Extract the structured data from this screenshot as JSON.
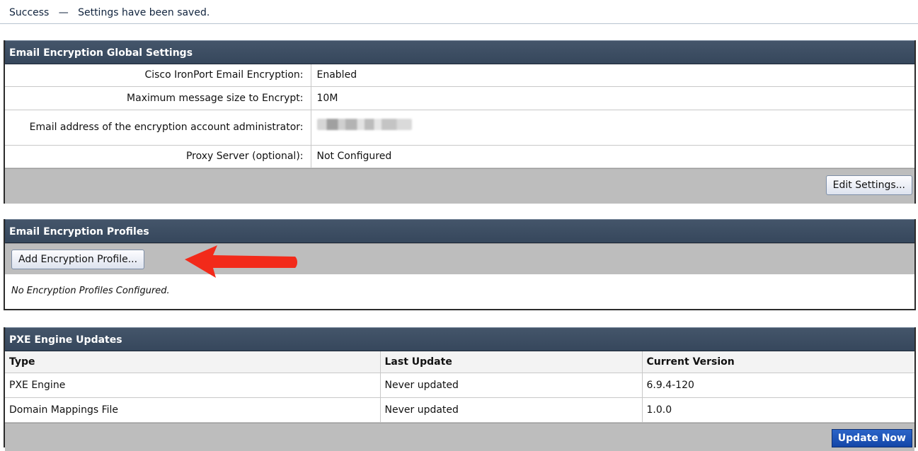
{
  "notification": {
    "status": "Success",
    "separator": "—",
    "message": "Settings have been saved."
  },
  "global_settings": {
    "title": "Email Encryption Global Settings",
    "rows": [
      {
        "label": "Cisco IronPort Email Encryption:",
        "value": "Enabled"
      },
      {
        "label": "Maximum message size to Encrypt:",
        "value": "10M"
      },
      {
        "label": "Email address of the encryption account administrator:",
        "value": ""
      },
      {
        "label": "Proxy Server (optional):",
        "value": "Not Configured"
      }
    ],
    "edit_button": "Edit Settings..."
  },
  "profiles": {
    "title": "Email Encryption Profiles",
    "add_button": "Add Encryption Profile...",
    "empty_message": "No Encryption Profiles Configured."
  },
  "pxe_updates": {
    "title": "PXE Engine Updates",
    "columns": [
      "Type",
      "Last Update",
      "Current Version"
    ],
    "rows": [
      [
        "PXE Engine",
        "Never updated",
        "6.9.4-120"
      ],
      [
        "Domain Mappings File",
        "Never updated",
        "1.0.0"
      ]
    ],
    "update_button": "Update Now"
  },
  "colors": {
    "header": "#3d4e63",
    "footer": "#bdbdbd",
    "primary_button": "#1a4fb8",
    "arrow": "#f22a1a"
  }
}
